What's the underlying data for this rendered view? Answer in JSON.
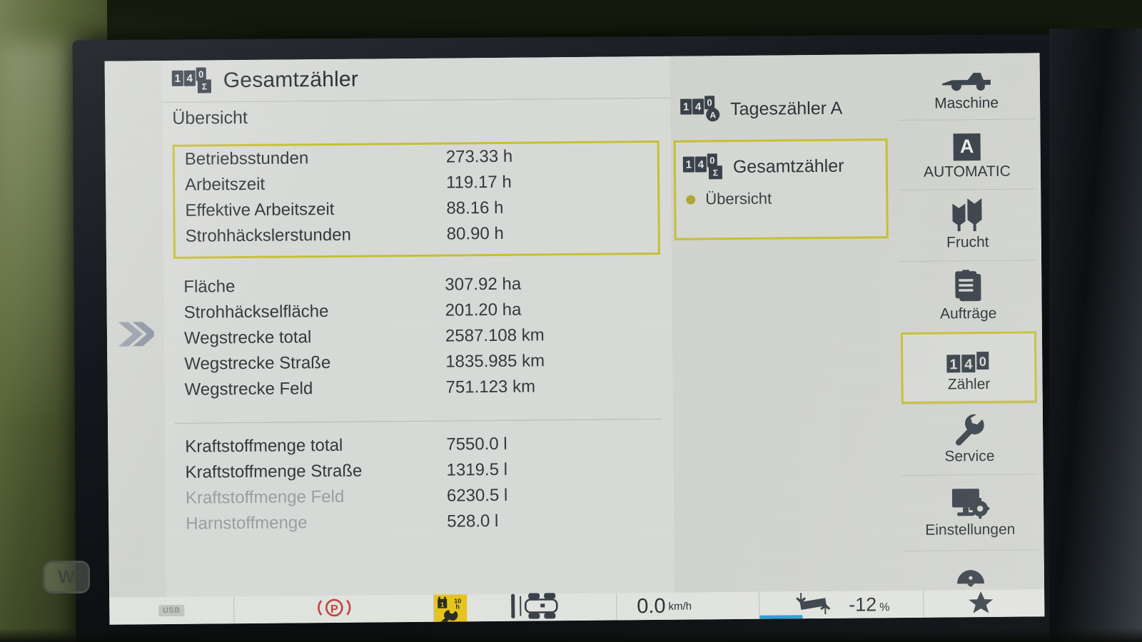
{
  "device": {
    "bezel_logo": "W"
  },
  "header": {
    "icon": "counter-total-icon",
    "title": "Gesamtzähler",
    "subtitle": "Übersicht"
  },
  "left_rail": {
    "expand_icon": "double-chevron-right-icon"
  },
  "colors": {
    "selection": "#c6c134",
    "screen_bg": "#d9dbd8",
    "text": "#35393d",
    "text_dim": "#9aa0a3",
    "icon_dark": "#3a424a",
    "warning_yellow": "#e8c520",
    "alert_red": "#c0453d",
    "accent_blue": "#2b9fd4"
  },
  "main": {
    "groups": [
      {
        "selected": true,
        "rows": [
          {
            "label": "Betriebsstunden",
            "value": "273.33 h",
            "dim": false
          },
          {
            "label": "Arbeitszeit",
            "value": "119.17 h",
            "dim": false
          },
          {
            "label": "Effektive Arbeitszeit",
            "value": "88.16 h",
            "dim": false
          },
          {
            "label": "Strohhäckslerstunden",
            "value": "80.90 h",
            "dim": false
          }
        ]
      },
      {
        "selected": false,
        "rows": [
          {
            "label": "Fläche",
            "value": "307.92 ha",
            "dim": false
          },
          {
            "label": "Strohhäckselfläche",
            "value": "201.20 ha",
            "dim": false
          },
          {
            "label": "Wegstrecke total",
            "value": "2587.108 km",
            "dim": false
          },
          {
            "label": "Wegstrecke Straße",
            "value": "1835.985 km",
            "dim": false
          },
          {
            "label": "Wegstrecke Feld",
            "value": "751.123 km",
            "dim": false
          }
        ]
      },
      {
        "selected": false,
        "rows": [
          {
            "label": "Kraftstoffmenge total",
            "value": "7550.0 l",
            "dim": false
          },
          {
            "label": "Kraftstoffmenge Straße",
            "value": "1319.5 l",
            "dim": false
          },
          {
            "label": "Kraftstoffmenge Feld",
            "value": "6230.5 l",
            "dim": true
          },
          {
            "label": "Harnstoffmenge",
            "value": "528.0 l",
            "dim": true
          }
        ]
      }
    ]
  },
  "counter_panel": {
    "items": [
      {
        "label": "Tageszähler A",
        "icon": "counter-day-a-icon",
        "badge": "A",
        "badge_round": true,
        "selected": false
      },
      {
        "label": "Gesamtzähler",
        "icon": "counter-total-icon",
        "badge": "Σ",
        "badge_round": false,
        "selected": true
      }
    ],
    "sub_items": [
      {
        "label": "Übersicht",
        "selected": true
      }
    ]
  },
  "sidebar": {
    "items": [
      {
        "label": "Maschine",
        "icon": "combine-machine-icon",
        "active": false
      },
      {
        "label": "AUTOMATIC",
        "icon": "automatic-a-icon",
        "active": false
      },
      {
        "label": "Frucht",
        "icon": "wheat-ears-icon",
        "active": false
      },
      {
        "label": "Aufträge",
        "icon": "clipboard-tasks-icon",
        "active": false
      },
      {
        "label": "Zähler",
        "icon": "counter-14-icon",
        "active": true
      },
      {
        "label": "Service",
        "icon": "wrench-icon",
        "active": false
      },
      {
        "label": "Einstellungen",
        "icon": "monitor-gear-icon",
        "active": false
      }
    ],
    "counter_icon_digits": "140"
  },
  "status_bar": {
    "usb_label": "USB",
    "parking_brake_icon": "parking-brake-icon",
    "parking_brake_label": "P",
    "service_due": {
      "icon": "service-wrench-icon",
      "value": "10",
      "unit": "h",
      "calendar_day": "1"
    },
    "machine_icon": "combine-top-view-icon",
    "speed": {
      "value": "0.0",
      "unit": "km/h",
      "sub_value": "0"
    },
    "slope": {
      "icon": "slope-incline-icon",
      "value": "-12",
      "unit": "%"
    },
    "favorite_icon": "star-icon"
  }
}
